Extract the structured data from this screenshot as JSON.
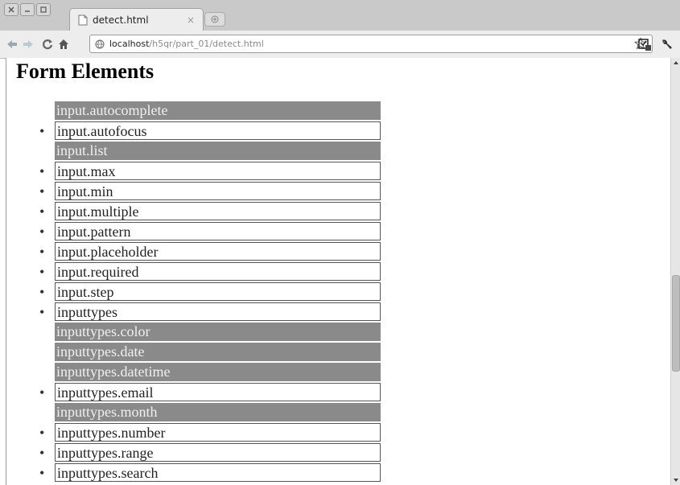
{
  "tab": {
    "title": "detect.html",
    "close": "×"
  },
  "url": {
    "host": "localhost",
    "path": "/h5qr/part_01/detect.html"
  },
  "page": {
    "heading": "Form Elements"
  },
  "features": [
    {
      "label": "input.autocomplete",
      "supported": false
    },
    {
      "label": "input.autofocus",
      "supported": true
    },
    {
      "label": "input.list",
      "supported": false
    },
    {
      "label": "input.max",
      "supported": true
    },
    {
      "label": "input.min",
      "supported": true
    },
    {
      "label": "input.multiple",
      "supported": true
    },
    {
      "label": "input.pattern",
      "supported": true
    },
    {
      "label": "input.placeholder",
      "supported": true
    },
    {
      "label": "input.required",
      "supported": true
    },
    {
      "label": "input.step",
      "supported": true
    },
    {
      "label": "inputtypes",
      "supported": true
    },
    {
      "label": "inputtypes.color",
      "supported": false
    },
    {
      "label": "inputtypes.date",
      "supported": false
    },
    {
      "label": "inputtypes.datetime",
      "supported": false
    },
    {
      "label": "inputtypes.email",
      "supported": true
    },
    {
      "label": "inputtypes.month",
      "supported": false
    },
    {
      "label": "inputtypes.number",
      "supported": true
    },
    {
      "label": "inputtypes.range",
      "supported": true
    },
    {
      "label": "inputtypes.search",
      "supported": true
    }
  ],
  "icons": {
    "back": "back-arrow-icon",
    "forward": "forward-arrow-icon",
    "reload": "reload-icon",
    "home": "home-icon",
    "star": "star-icon",
    "wrench": "wrench-icon"
  }
}
